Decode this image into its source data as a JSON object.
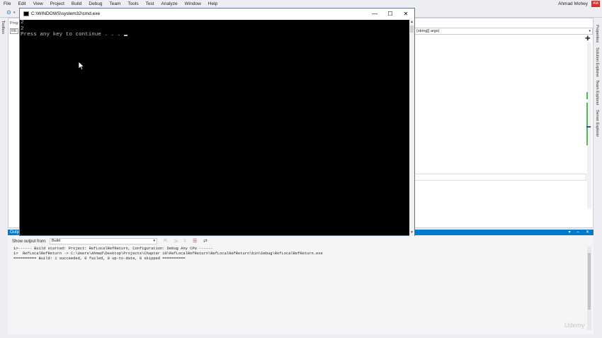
{
  "menu": [
    "File",
    "Edit",
    "View",
    "Project",
    "Build",
    "Debug",
    "Team",
    "Tools",
    "Test",
    "Analyze",
    "Window",
    "Help"
  ],
  "account": {
    "name": "Ahmad Mohey",
    "initials": "AM"
  },
  "left_tabs": [
    "Toolbox"
  ],
  "right_tabs": [
    "Properties",
    "Solution Explorer",
    "Team Explorer",
    "Server Explorer"
  ],
  "editor": {
    "nav_member": "(string[] args)",
    "doc_tab_fragments": [
      "Prog",
      "RE"
    ]
  },
  "cmd": {
    "title": "C:\\WINDOWS\\system32\\cmd.exe",
    "lines": [
      "2",
      "2",
      "Press any key to continue . . . "
    ],
    "buttons": {
      "minimize": "—",
      "maximize": "☐",
      "close": "✕"
    }
  },
  "output": {
    "title": "Outp",
    "show_from_label": "Show output from:",
    "source": "Build",
    "lines": [
      "1>------ Build started: Project: RefLocalRefReturn, Configuration: Debug Any CPU ------",
      "1>  RefLocalRefReturn -> C:\\Users\\Ahmad\\Desktop\\Projects\\Chapter 10\\RefLocalRefReturn\\RefLocalRefReturn\\bin\\Debug\\RefLocalRefReturn.exe",
      "========== Build: 1 succeeded, 0 failed, 0 up-to-date, 0 skipped =========="
    ],
    "controls": "▾ ⇔ ✕"
  },
  "watermark": "Udemy",
  "colors": {
    "accent": "#007acc",
    "console_bg": "#000000",
    "console_fg": "#c0c0c0",
    "avatar": "#d9322e"
  }
}
